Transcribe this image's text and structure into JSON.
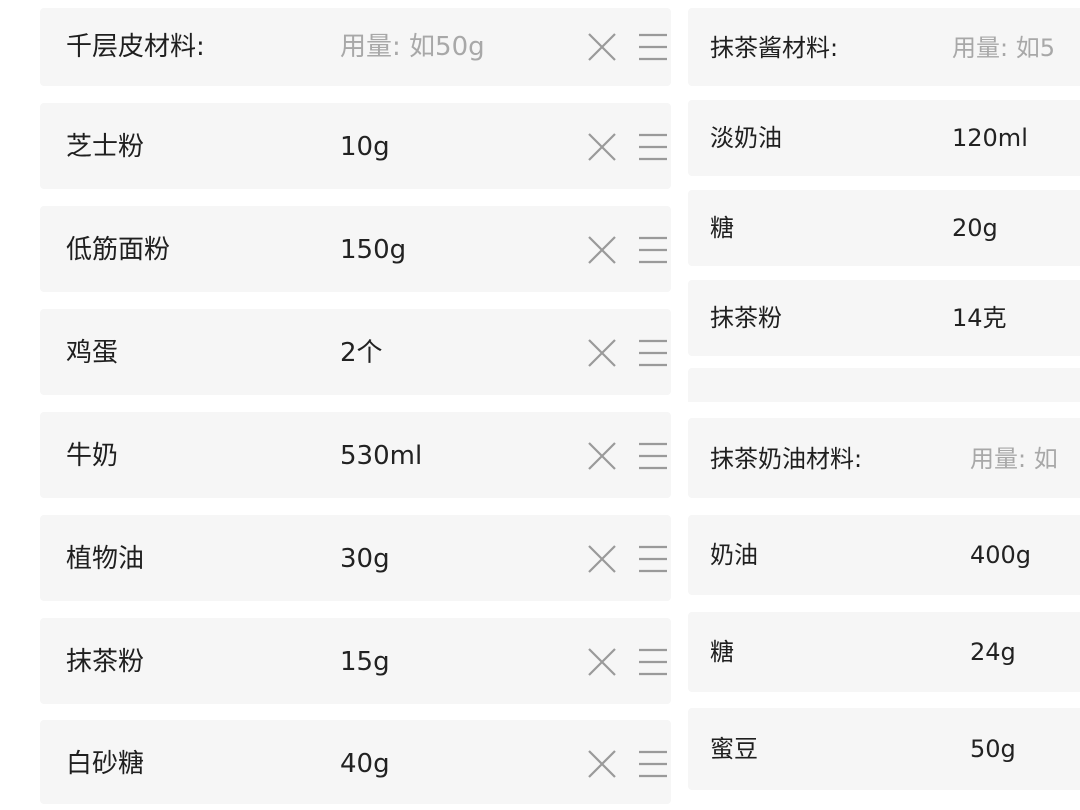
{
  "left_group": {
    "header": {
      "name": "千层皮材料:",
      "placeholder": "用量: 如50g"
    },
    "items": [
      {
        "name": "芝士粉",
        "qty": "10g"
      },
      {
        "name": "低筋面粉",
        "qty": "150g"
      },
      {
        "name": "鸡蛋",
        "qty": "2个"
      },
      {
        "name": "牛奶",
        "qty": "530ml"
      },
      {
        "name": "植物油",
        "qty": "30g"
      },
      {
        "name": "抹茶粉",
        "qty": "15g"
      },
      {
        "name": "白砂糖",
        "qty": "40g"
      }
    ]
  },
  "right_group_1": {
    "header": {
      "name": "抹茶酱材料:",
      "placeholder": "用量: 如5"
    },
    "items": [
      {
        "name": "淡奶油",
        "qty": "120ml"
      },
      {
        "name": "糖",
        "qty": "20g"
      },
      {
        "name": "抹茶粉",
        "qty": "14克"
      }
    ]
  },
  "right_group_2": {
    "header": {
      "name": "抹茶奶油材料:",
      "placeholder": "用量: 如"
    },
    "items": [
      {
        "name": "奶油",
        "qty": "400g"
      },
      {
        "name": "糖",
        "qty": "24g"
      },
      {
        "name": "蜜豆",
        "qty": "50g"
      }
    ]
  },
  "icons": {
    "delete": "close-icon",
    "drag": "drag-handle-icon"
  },
  "colors": {
    "row_bg": "#f6f6f6",
    "text": "#222222",
    "placeholder": "#a8a8a8",
    "icon": "#9a9a9a"
  }
}
